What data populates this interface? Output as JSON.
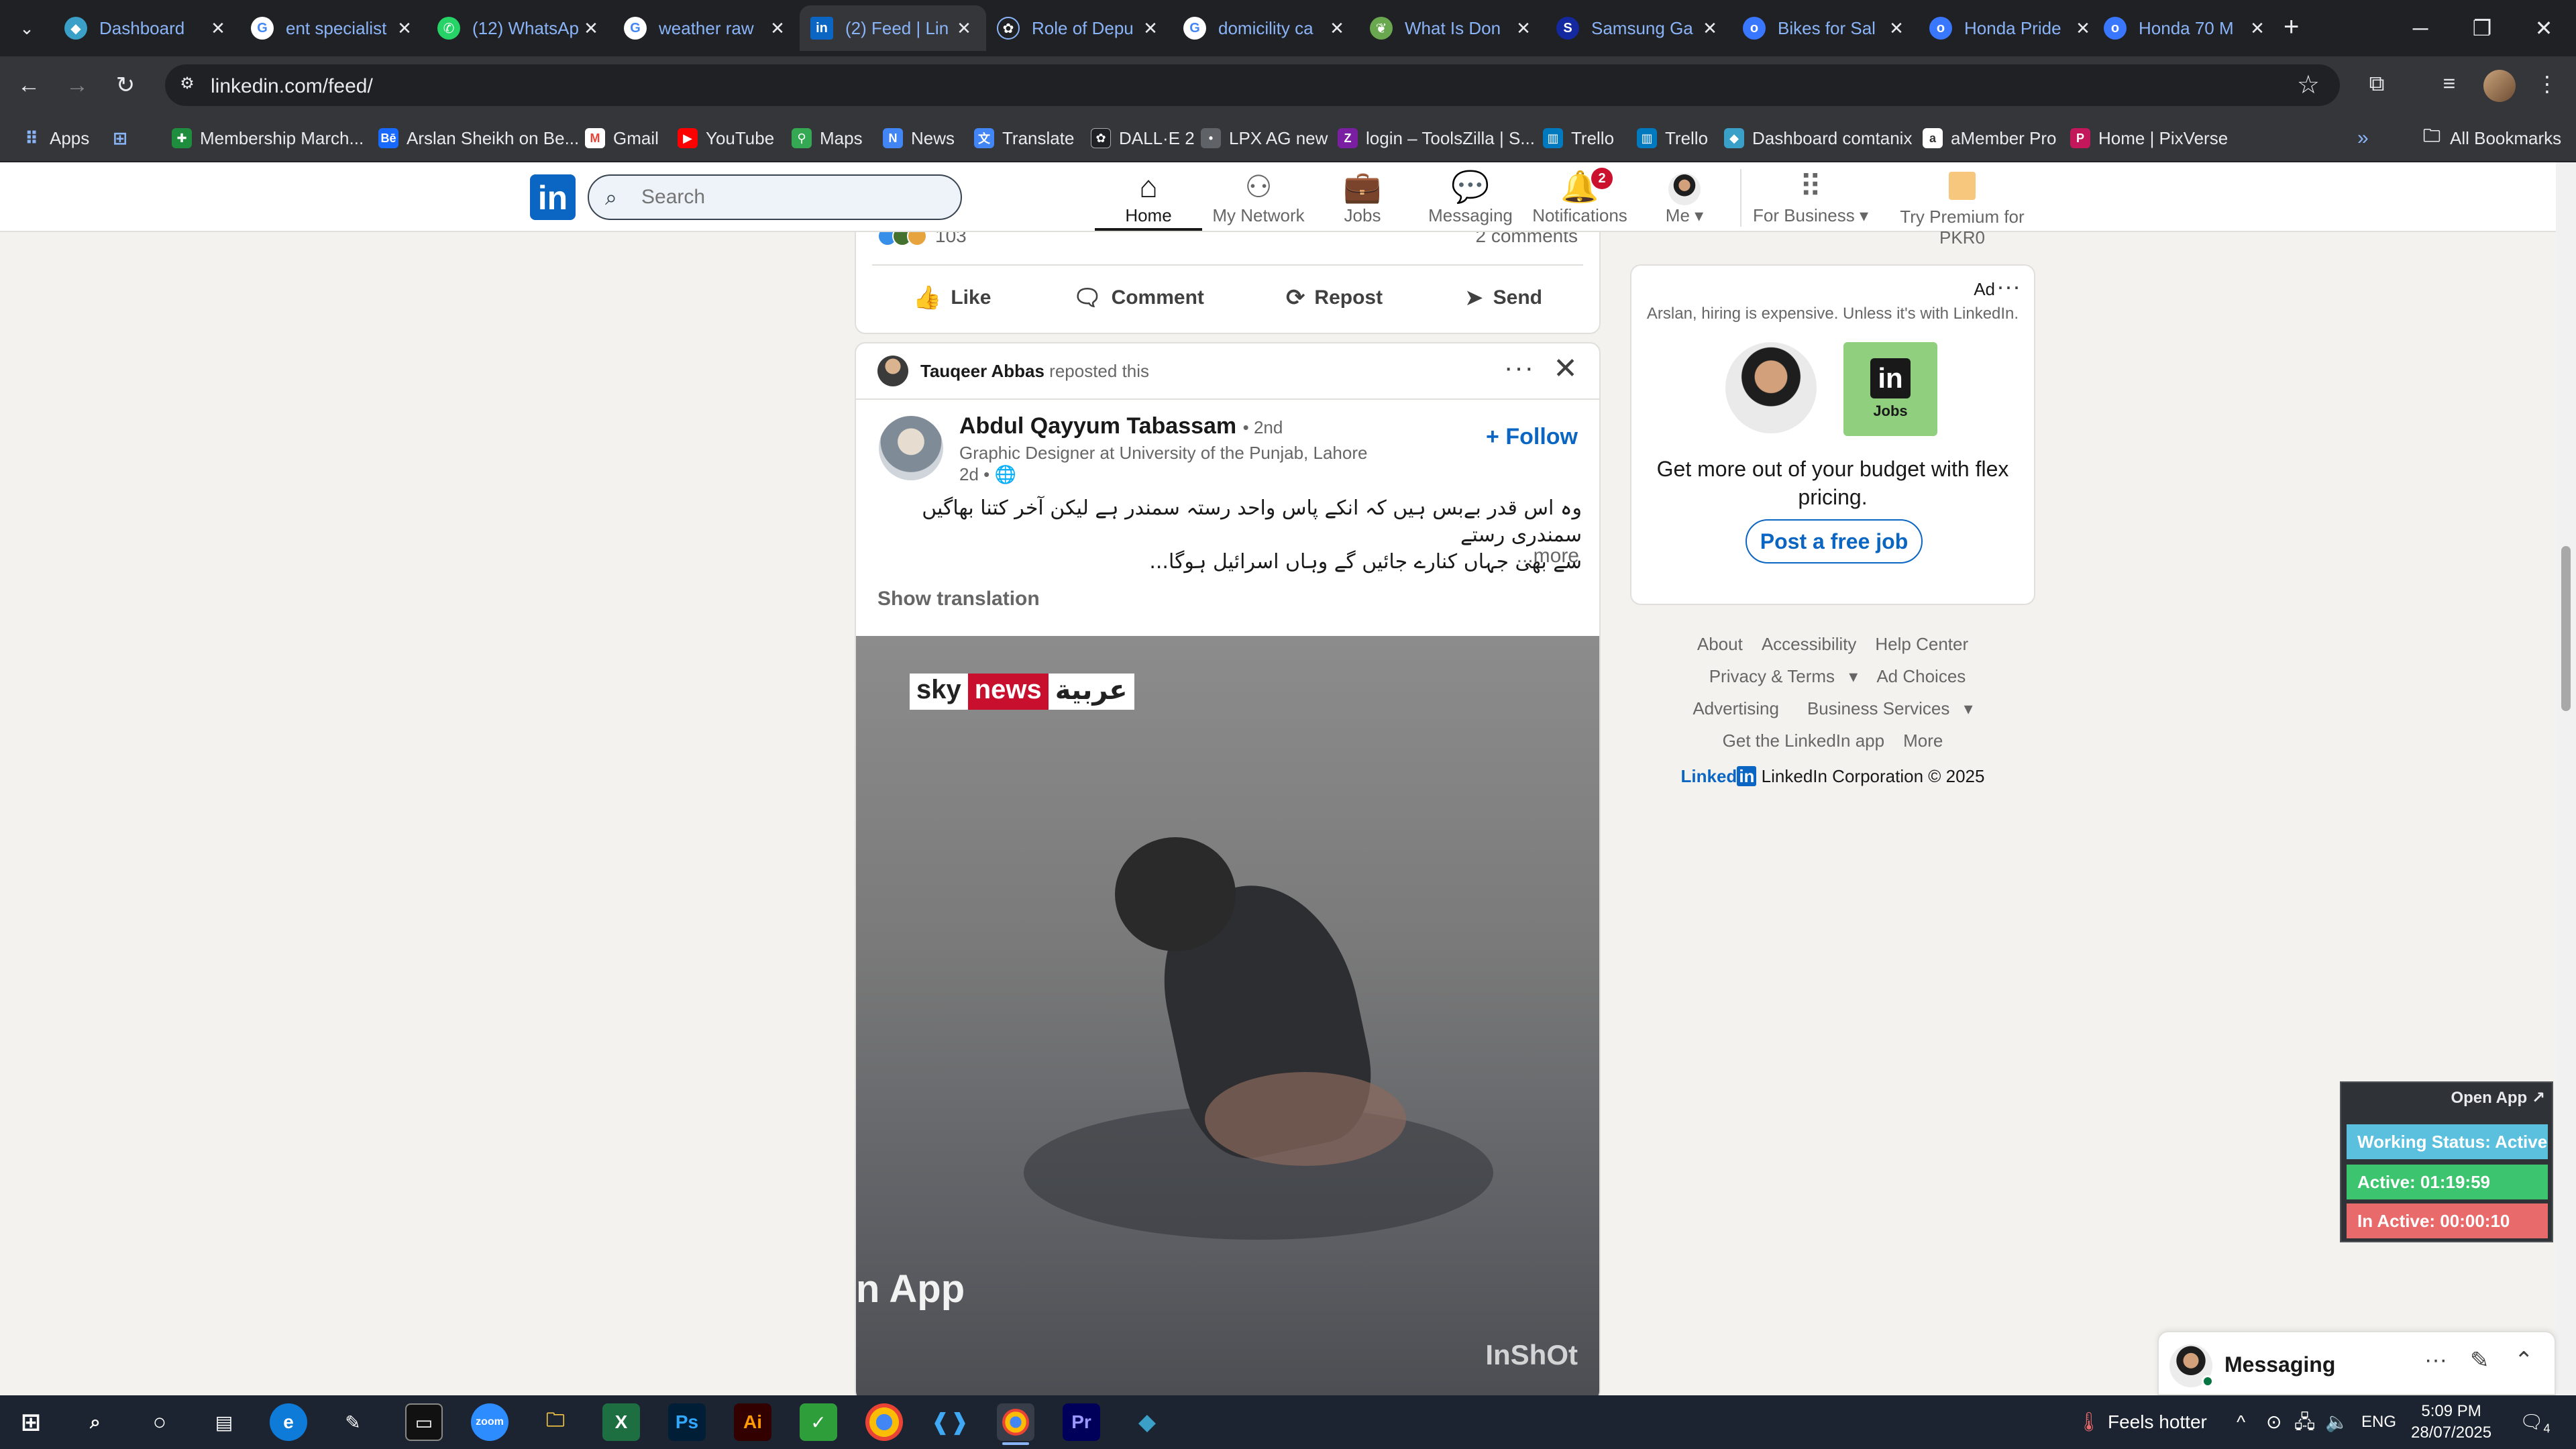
{
  "browser": {
    "tabs": [
      {
        "title": "Dashboard",
        "icon": "dashboard-favicon",
        "color": "#3aa0c8"
      },
      {
        "title": "ent specialist",
        "icon": "google-favicon",
        "color": "#4285f4"
      },
      {
        "title": "(12) WhatsApp",
        "icon": "whatsapp-favicon",
        "color": "#25d366"
      },
      {
        "title": "weather raw",
        "icon": "google-favicon",
        "color": "#4285f4"
      },
      {
        "title": "(2) Feed | Lin",
        "icon": "linkedin-favicon",
        "color": "#0a66c2"
      },
      {
        "title": "Role of Depu",
        "icon": "openai-favicon",
        "color": "#202124"
      },
      {
        "title": "domicility ca",
        "icon": "google-favicon",
        "color": "#4285f4"
      },
      {
        "title": "What Is Don",
        "icon": "leaf-favicon",
        "color": "#6aa84f"
      },
      {
        "title": "Samsung Ga",
        "icon": "samsung-favicon",
        "color": "#1428a0"
      },
      {
        "title": "Bikes for Sal",
        "icon": "olx-favicon",
        "color": "#3a77ff"
      },
      {
        "title": "Honda Pride",
        "icon": "olx-favicon",
        "color": "#3a77ff"
      },
      {
        "title": "Honda 70 M",
        "icon": "olx-favicon",
        "color": "#3a77ff"
      }
    ],
    "url": "linkedin.com/feed/",
    "bookmarks": [
      {
        "label": "Apps",
        "icon": "apps-grid-icon"
      },
      {
        "label": "",
        "icon": "tab-groups-icon"
      },
      {
        "label": "Membership March...",
        "icon": "bookmark-favicon"
      },
      {
        "label": "Arslan Sheikh on Be...",
        "icon": "behance-favicon"
      },
      {
        "label": "Gmail",
        "icon": "gmail-favicon"
      },
      {
        "label": "YouTube",
        "icon": "youtube-favicon"
      },
      {
        "label": "Maps",
        "icon": "maps-favicon"
      },
      {
        "label": "News",
        "icon": "news-favicon"
      },
      {
        "label": "Translate",
        "icon": "translate-favicon"
      },
      {
        "label": "DALL·E 2",
        "icon": "openai-favicon"
      },
      {
        "label": "LPX AG new",
        "icon": "bookmark-favicon"
      },
      {
        "label": "login – ToolsZilla | S...",
        "icon": "toolszilla-favicon"
      },
      {
        "label": "Trello",
        "icon": "trello-favicon"
      },
      {
        "label": "Trello",
        "icon": "trello-favicon"
      },
      {
        "label": "Dashboard comtanix",
        "icon": "dashboard-favicon"
      },
      {
        "label": "aMember Pro",
        "icon": "amember-favicon"
      },
      {
        "label": "Home | PixVerse",
        "icon": "pixverse-favicon"
      }
    ],
    "all_bookmarks": "All Bookmarks"
  },
  "linkedin": {
    "search_placeholder": "Search",
    "nav": [
      {
        "label": "Home",
        "icon": "home-icon"
      },
      {
        "label": "My Network",
        "icon": "network-icon"
      },
      {
        "label": "Jobs",
        "icon": "briefcase-icon"
      },
      {
        "label": "Messaging",
        "icon": "chat-icon"
      },
      {
        "label": "Notifications",
        "icon": "bell-icon",
        "badge": "2"
      },
      {
        "label": "Me",
        "icon": "avatar"
      },
      {
        "label": "For Business",
        "icon": "grid-icon"
      },
      {
        "label": "Try Premium for PKR0",
        "icon": "premium-icon"
      }
    ],
    "prev_post": {
      "reaction_count": "103",
      "comments": "2 comments",
      "actions": [
        "Like",
        "Comment",
        "Repost",
        "Send"
      ]
    },
    "post": {
      "reposter": "Tauqeer Abbas",
      "reposted_text": "reposted this",
      "author": "Abdul Qayyum Tabassam",
      "degree": "• 2nd",
      "headline": "Graphic Designer at University of the Punjab, Lahore",
      "time": "2d •",
      "follow": "+ Follow",
      "text_line1": "وہ اس قدر بےبس ہیں کہ انکے پاس واحد رستہ سمندر ہے لیکن آخر کتنا بھاگیں سمندری رستے",
      "text_line2": "سے بھی جہاں کنارے جائیں گے وہاں اسرائیل ہوگا...",
      "more": "...more",
      "show_translation": "Show translation",
      "video": {
        "logo_sky": "sky",
        "logo_news": "news",
        "logo_arabic": "عربية",
        "caption": "n App",
        "watermark": "InShOt"
      }
    },
    "ad": {
      "label": "Ad",
      "subtitle": "Arslan, hiring is expensive. Unless it's with LinkedIn.",
      "jobs_label": "Jobs",
      "title": "Get more out of your budget with flex pricing.",
      "button": "Post a free job"
    },
    "footer": {
      "links": [
        "About",
        "Accessibility",
        "Help Center",
        "Privacy & Terms",
        "Ad Choices",
        "Advertising",
        "Business Services",
        "Get the LinkedIn app",
        "More"
      ],
      "logo": "Linked",
      "copyright": "LinkedIn Corporation © 2025"
    },
    "messaging": {
      "title": "Messaging"
    }
  },
  "tracker": {
    "open_app": "Open App ↗",
    "working_status": "Working Status: Active",
    "active": "Active: 01:19:59",
    "inactive": "In Active: 00:00:10",
    "colors": {
      "status": "#5bc0de",
      "active": "#3cc46f",
      "inactive": "#e86a6a"
    }
  },
  "taskbar": {
    "weather": "Feels hotter",
    "lang": "ENG",
    "time": "5:09 PM",
    "date": "28/07/2025",
    "notification_count": "4"
  }
}
